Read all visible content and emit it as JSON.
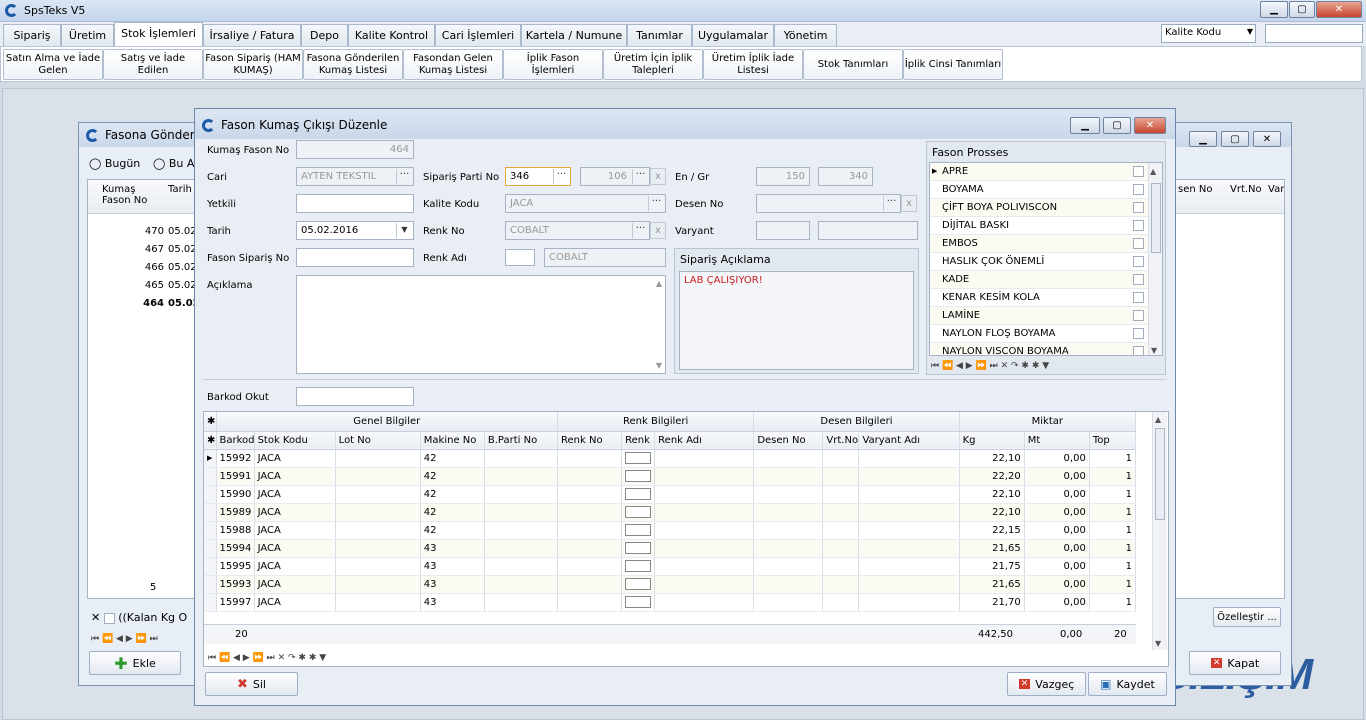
{
  "app": {
    "title": "SpsTeks V5"
  },
  "menu": {
    "tabs": [
      "Sipariş",
      "Üretim",
      "Stok İşlemleri",
      "İrsaliye / Fatura",
      "Depo",
      "Kalite Kontrol",
      "Cari İşlemleri",
      "Kartela / Numune",
      "Tanımlar",
      "Uygulamalar",
      "Yönetim"
    ],
    "active": "Stok İşlemleri",
    "kalite_combo": "Kalite Kodu"
  },
  "subbar": {
    "buttons": [
      "Satın Alma ve İade Gelen",
      "Satış ve İade Edilen",
      "Fason Sipariş (HAM KUMAŞ)",
      "Fasona Gönderilen Kumaş Listesi",
      "Fasondan Gelen Kumaş Listesi",
      "İplik Fason İşlemleri",
      "Üretim İçin İplik Talepleri",
      "Üretim İplik İade Listesi",
      "Stok Tanımları",
      "İplik Cinsi Tanımları"
    ]
  },
  "bgwin": {
    "title": "Fasona Gönderile",
    "radio1": "Bugün",
    "radio2": "Bu A",
    "col_kumas": "Kumaş Fason No",
    "col_tarih": "Tarih",
    "rows": [
      {
        "no": "470",
        "t": "05.02"
      },
      {
        "no": "467",
        "t": "05.02"
      },
      {
        "no": "466",
        "t": "05.02"
      },
      {
        "no": "465",
        "t": "05.02"
      },
      {
        "no": "464",
        "t": "05.02"
      }
    ],
    "right_cols": [
      "sen No",
      "Vrt.No",
      "Var"
    ],
    "count": "5",
    "filter": "((Kalan Kg O",
    "ozellestir": "Özelleştir ...",
    "ekle": "Ekle",
    "kapat": "Kapat"
  },
  "dialog": {
    "title": "Fason Kumaş Çıkışı Düzenle",
    "labels": {
      "kumas_fason_no": "Kumaş Fason No",
      "cari": "Cari",
      "yetkili": "Yetkili",
      "tarih": "Tarih",
      "fason_siparis_no": "Fason Sipariş No",
      "aciklama": "Açıklama",
      "siparis_parti_no": "Sipariş Parti No",
      "kalite_kodu": "Kalite Kodu",
      "renk_no": "Renk No",
      "renk_adi": "Renk Adı",
      "en_gr": "En / Gr",
      "desen_no": "Desen No",
      "varyant": "Varyant",
      "siparis_aciklama": "Sipariş Açıklama",
      "barkod_okut": "Barkod Okut"
    },
    "values": {
      "kumas_fason_no": "464",
      "cari": "AYTEN TEKSTIL",
      "tarih": "05.02.2016",
      "siparis_parti_no": "346",
      "parti2": "106",
      "kalite_kodu": "JACA",
      "renk_no": "COBALT",
      "renk_adi": "COBALT",
      "en": "150",
      "gr": "340",
      "siparis_aciklama": "LAB ÇALIŞIYOR!"
    },
    "prosses": {
      "title": "Fason Prosses",
      "items": [
        "APRE",
        "BOYAMA",
        "ÇİFT BOYA POLIVISCON",
        "DİJİTAL BASKI",
        "EMBOS",
        "HASLIK ÇOK ÖNEMLİ",
        "KADE",
        "KENAR KESİM KOLA",
        "LAMİNE",
        "NAYLON FLOŞ BOYAMA",
        "NAYLON VISCON BOYAMA"
      ]
    },
    "grid": {
      "groups": [
        "Genel Bilgiler",
        "Renk Bilgileri",
        "Desen Bilgileri",
        "Miktar"
      ],
      "cols": [
        "Barkod",
        "Stok Kodu",
        "Lot No",
        "Makine No",
        "B.Parti No",
        "Renk No",
        "Renk",
        "Renk Adı",
        "Desen No",
        "Vrt.No",
        "Varyant Adı",
        "Kg",
        "Mt",
        "Top"
      ],
      "rows": [
        {
          "barkod": "15992",
          "stok": "JACA",
          "makine": "42",
          "kg": "22,10",
          "mt": "0,00",
          "top": "1"
        },
        {
          "barkod": "15991",
          "stok": "JACA",
          "makine": "42",
          "kg": "22,20",
          "mt": "0,00",
          "top": "1"
        },
        {
          "barkod": "15990",
          "stok": "JACA",
          "makine": "42",
          "kg": "22,10",
          "mt": "0,00",
          "top": "1"
        },
        {
          "barkod": "15989",
          "stok": "JACA",
          "makine": "42",
          "kg": "22,10",
          "mt": "0,00",
          "top": "1"
        },
        {
          "barkod": "15988",
          "stok": "JACA",
          "makine": "42",
          "kg": "22,15",
          "mt": "0,00",
          "top": "1"
        },
        {
          "barkod": "15994",
          "stok": "JACA",
          "makine": "43",
          "kg": "21,65",
          "mt": "0,00",
          "top": "1"
        },
        {
          "barkod": "15995",
          "stok": "JACA",
          "makine": "43",
          "kg": "21,75",
          "mt": "0,00",
          "top": "1"
        },
        {
          "barkod": "15993",
          "stok": "JACA",
          "makine": "43",
          "kg": "21,65",
          "mt": "0,00",
          "top": "1"
        },
        {
          "barkod": "15997",
          "stok": "JACA",
          "makine": "43",
          "kg": "21,70",
          "mt": "0,00",
          "top": "1"
        }
      ],
      "footer": {
        "count": "20",
        "kg": "442,50",
        "mt": "0,00",
        "top": "20"
      }
    },
    "buttons": {
      "sil": "Sil",
      "vazgec": "Vazgeç",
      "kaydet": "Kaydet"
    }
  },
  "brand": "BU BİLİŞİM"
}
